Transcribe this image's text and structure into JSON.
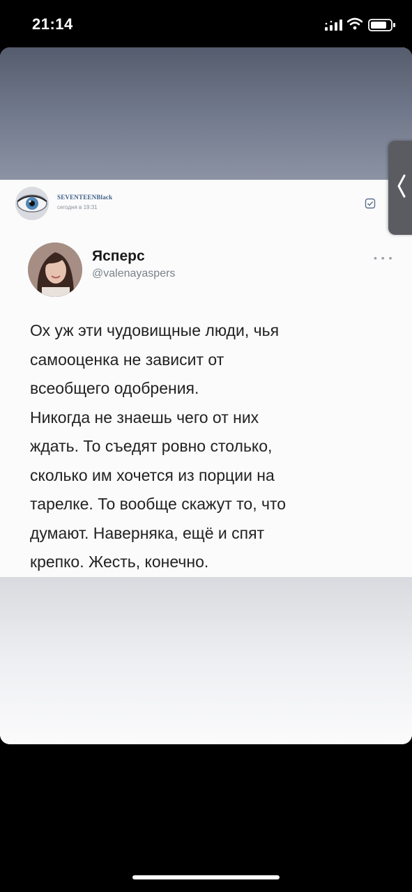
{
  "status_bar": {
    "time": "21:14"
  },
  "vk_post": {
    "author": "SEVENTEENBlack",
    "time": "сегодня в 19:31"
  },
  "tweet": {
    "name": "Ясперс",
    "handle": "@valenayaspers",
    "lines": [
      "Ох уж эти чудовищные люди, чья",
      "самооценка не зависит от",
      "всеобщего одобрения.",
      "Никогда не знаешь чего от них",
      "ждать. То съедят ровно столько,",
      "сколько им хочется из порции на",
      "тарелке. То вообще скажут то, что",
      "думают. Наверняка, ещё и спят",
      "крепко. Жесть, конечно."
    ]
  },
  "icons": {
    "signal": "signal-icon",
    "wifi": "wifi-icon",
    "battery": "battery-icon",
    "bookmark": "bookmark-icon",
    "more": "more-icon",
    "chevron": "chevron-left-icon"
  },
  "colors": {
    "background": "#000000",
    "top_gradient": "#545c6d",
    "post_background": "#fbfbfc",
    "author_link": "#3f5f86",
    "tweet_text": "#222222",
    "handle_gray": "#7b8187"
  }
}
